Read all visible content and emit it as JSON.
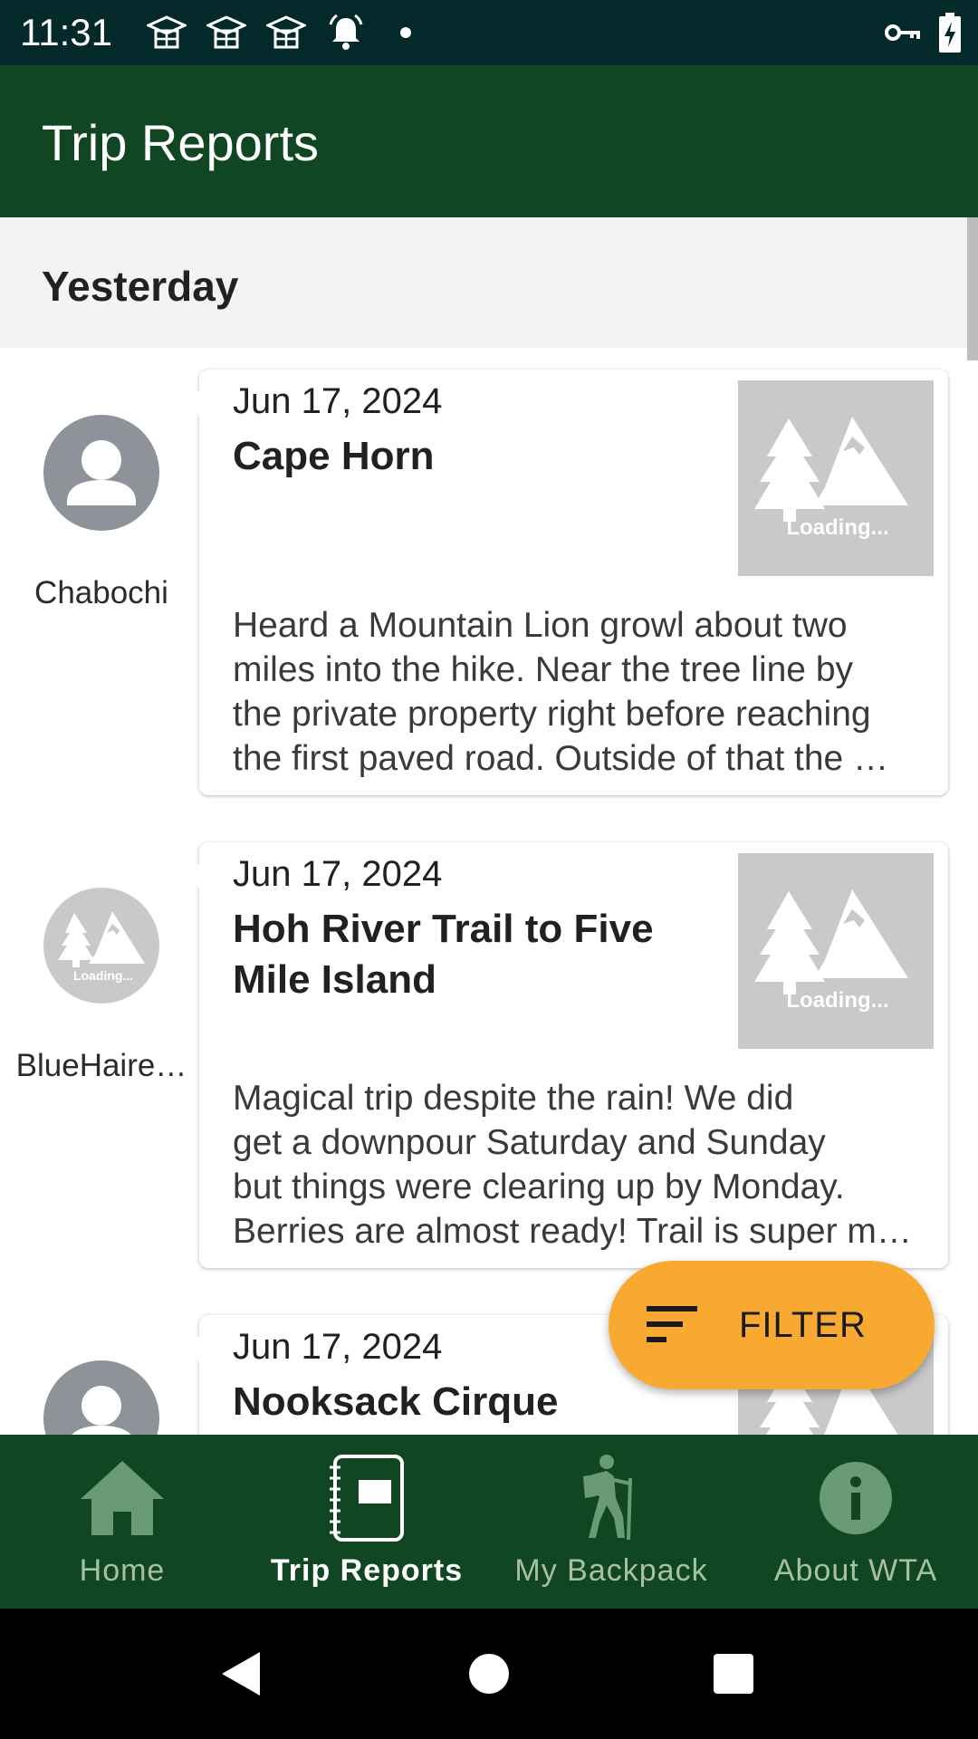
{
  "status_bar": {
    "time": "11:31",
    "left_icons": [
      "graduation-cap-icon",
      "graduation-cap-icon",
      "graduation-cap-icon",
      "alarm-bell-icon",
      "dot-icon"
    ],
    "right_icons": [
      "vpn-key-icon",
      "battery-charging-icon"
    ]
  },
  "app_bar": {
    "title": "Trip Reports"
  },
  "section": {
    "title": "Yesterday"
  },
  "reports": [
    {
      "author": "Chabochi",
      "avatar": "person-icon",
      "date": "Jun 17, 2024",
      "title": "Cape Horn",
      "thumb_text": "Loading...",
      "body_lines": [
        "Heard a Mountain Lion growl about two",
        "miles into the hike. Near the tree line by",
        "the private property right before reaching",
        "the first paved road. Outside of that the …"
      ]
    },
    {
      "author": "BlueHaire…",
      "avatar": "loading-placeholder",
      "avatar_text": "Loading...",
      "date": "Jun 17, 2024",
      "title": "Hoh River Trail to Five Mile Island",
      "thumb_text": "Loading...",
      "body_lines": [
        "Magical trip despite the rain! We did",
        "get a downpour Saturday and Sunday",
        "but things were clearing up by Monday.",
        "Berries are almost ready! Trail is super m…"
      ]
    },
    {
      "author": "",
      "avatar": "person-icon",
      "date": "Jun 17, 2024",
      "title": "Nooksack Cirque",
      "thumb_text": "",
      "body_lines": []
    }
  ],
  "fab": {
    "label": "FILTER",
    "icon": "filter-list-icon"
  },
  "bottom_nav": {
    "items": [
      {
        "label": "Home",
        "icon": "home-icon",
        "active": false
      },
      {
        "label": "Trip Reports",
        "icon": "notebook-icon",
        "active": true
      },
      {
        "label": "My Backpack",
        "icon": "hiker-icon",
        "active": false
      },
      {
        "label": "About WTA",
        "icon": "info-icon",
        "active": false
      }
    ]
  },
  "colors": {
    "status_bar": "#04292a",
    "app_bar": "#114622",
    "fab": "#f8a932",
    "nav_inactive": "#a7c0a4",
    "placeholder": "#c9c9c9"
  }
}
